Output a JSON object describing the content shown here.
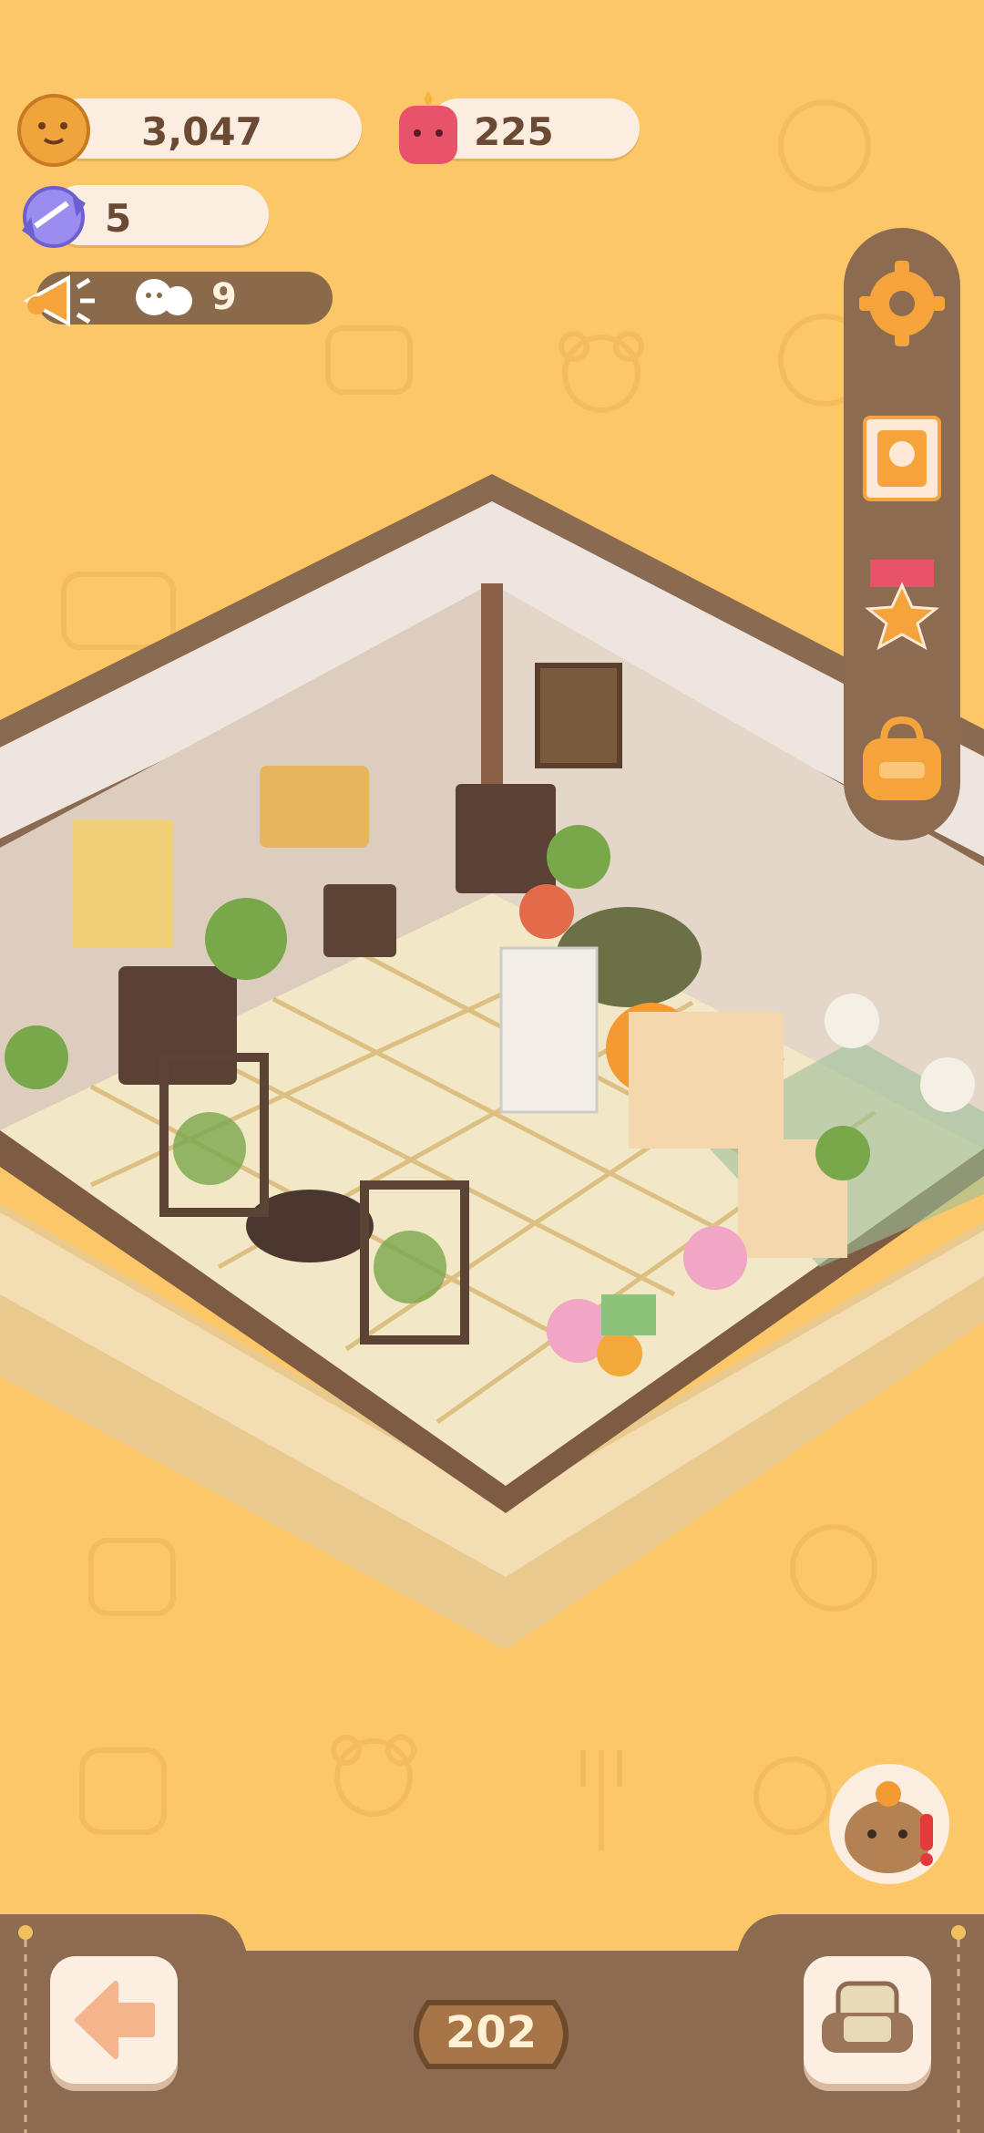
{
  "currencies": {
    "cookies": {
      "value": "3,047",
      "icon": "cookie-icon"
    },
    "hearts": {
      "value": "225",
      "icon": "candle-jelly-icon"
    },
    "candy": {
      "value": "5",
      "icon": "candy-icon"
    }
  },
  "guests": {
    "count": "9",
    "icon": "megaphone-icon"
  },
  "side_menu": [
    {
      "icon": "gear-icon",
      "label": "settings"
    },
    {
      "icon": "profile-card-icon",
      "label": "profile"
    },
    {
      "icon": "medal-icon",
      "label": "achievements"
    },
    {
      "icon": "bag-icon",
      "label": "inventory"
    }
  ],
  "bottom": {
    "level": "202",
    "back_icon": "arrow-left-icon",
    "furniture_icon": "armchair-icon"
  },
  "colors": {
    "background": "#fcc769",
    "panel": "#8c6b50",
    "pill": "#fbeee0",
    "text": "#6b4a35"
  }
}
